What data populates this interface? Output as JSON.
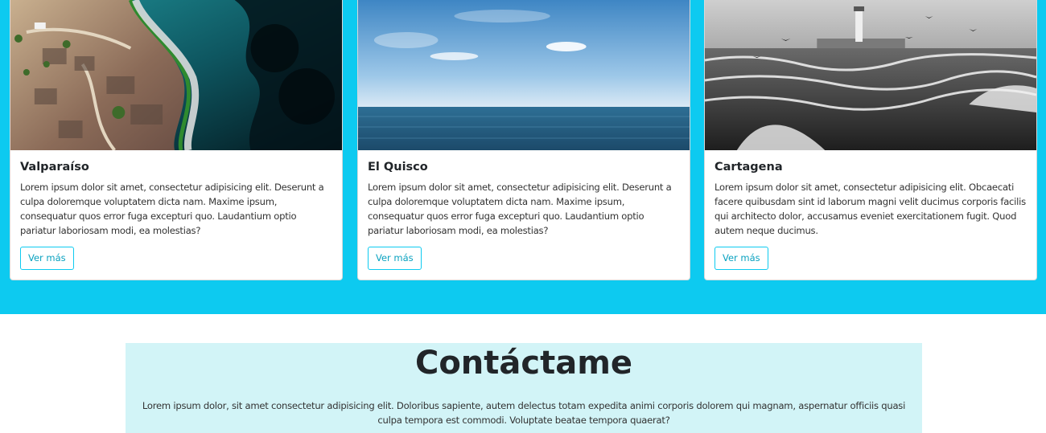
{
  "cards": [
    {
      "title": "Valparaíso",
      "text": "Lorem ipsum dolor sit amet, consectetur adipisicing elit. Deserunt a culpa doloremque voluptatem dicta nam. Maxime ipsum, consequatur quos error fuga excepturi quo. Laudantium optio pariatur laboriosam modi, ea molestias?",
      "button": "Ver más",
      "image": "aerial-coastline-photo"
    },
    {
      "title": "El Quisco",
      "text": "Lorem ipsum dolor sit amet, consectetur adipisicing elit. Deserunt a culpa doloremque voluptatem dicta nam. Maxime ipsum, consequatur quos error fuga excepturi quo. Laudantium optio pariatur laboriosam modi, ea molestias?",
      "button": "Ver más",
      "image": "ocean-horizon-photo"
    },
    {
      "title": "Cartagena",
      "text": "Lorem ipsum dolor sit amet, consectetur adipisicing elit. Obcaecati facere quibusdam sint id laborum magni velit ducimus corporis facilis qui architecto dolor, accusamus eveniet exercitationem fugit. Quod autem neque ducimus.",
      "button": "Ver más",
      "image": "lighthouse-waves-photo"
    }
  ],
  "contact": {
    "title": "Contáctame",
    "text": "Lorem ipsum dolor, sit amet consectetur adipisicing elit. Doloribus sapiente, autem delectus totam expedita animi corporis dolorem qui magnam, aspernatur officiis quasi culpa tempora est commodi. Voluptate beatae tempora quaerat?"
  },
  "colors": {
    "band": "#0dcaf0",
    "contact_background": "#d2f4f7",
    "button_border": "#0dcaf0"
  }
}
